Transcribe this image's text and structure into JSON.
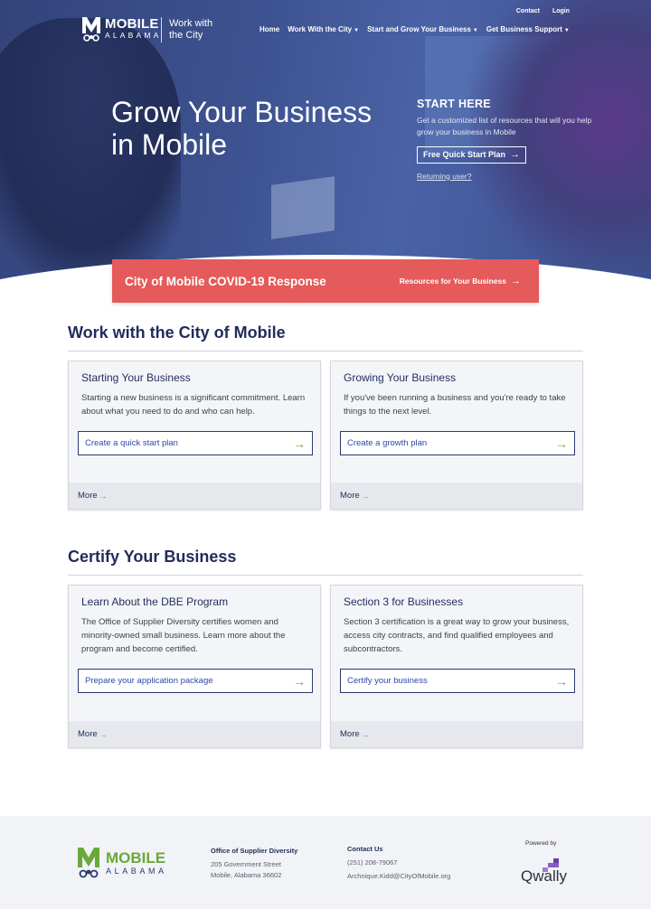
{
  "brand": {
    "name": "MOBILE",
    "sub": "ALABAMA",
    "tagline": "Work with the City",
    "accent": "#6aa83a",
    "navy": "#1f2c5c"
  },
  "util_nav": [
    "Contact",
    "Login"
  ],
  "main_nav": [
    {
      "label": "Home",
      "dropdown": false
    },
    {
      "label": "Work With the City",
      "dropdown": true
    },
    {
      "label": "Start and Grow Your Business",
      "dropdown": true
    },
    {
      "label": "Get Business Support",
      "dropdown": true
    }
  ],
  "hero": {
    "title": "Grow Your Business in Mobile",
    "start_here": {
      "title": "START HERE",
      "description": "Get a customized list of resources that will you help grow your business in Mobile",
      "button": "Free Quick Start Plan",
      "link": "Returning user?"
    }
  },
  "covid": {
    "title": "City of Mobile COVID-19 Response",
    "link": "Resources for Your Business",
    "color": "#e55a5a"
  },
  "sections": [
    {
      "title": "Work with the City of Mobile",
      "cards": [
        {
          "title": "Starting Your Business",
          "description": "Starting a new business is a significant commitment. Learn about what you need to do and who can help.",
          "button": "Create a quick start plan",
          "more": "More"
        },
        {
          "title": "Growing Your Business",
          "description": "If you've been running a business and you're ready to take things to the next level.",
          "button": "Create a growth plan",
          "more": "More"
        }
      ]
    },
    {
      "title": "Certify Your Business",
      "cards": [
        {
          "title": "Learn About the DBE Program",
          "description": "The Office of Supplier Diversity certifies women and minority-owned small business. Learn more about the program and become certified.",
          "button": "Prepare your application package",
          "more": "More"
        },
        {
          "title": "Section 3 for Businesses",
          "description": "Section 3 certification is a great way to grow your business, access city contracts, and find qualified employees and subcontractors.",
          "button": "Certify your business",
          "more": "More"
        }
      ]
    }
  ],
  "footer": {
    "office": {
      "title": "Office of Supplier Diversity",
      "address1": "205 Government Street",
      "address2": "Mobile, Alabama 36602"
    },
    "contact": {
      "title": "Contact Us",
      "phone": "(251) 208-79067",
      "email": "Archnique.Kidd@CityOfMobile.org"
    },
    "powered_by": "Powered by",
    "powered_brand": "Qwally"
  },
  "icons": {
    "arrow": "arrow-right-icon",
    "caret": "caret-down-icon",
    "logo": "mobile-m-logo-icon"
  }
}
